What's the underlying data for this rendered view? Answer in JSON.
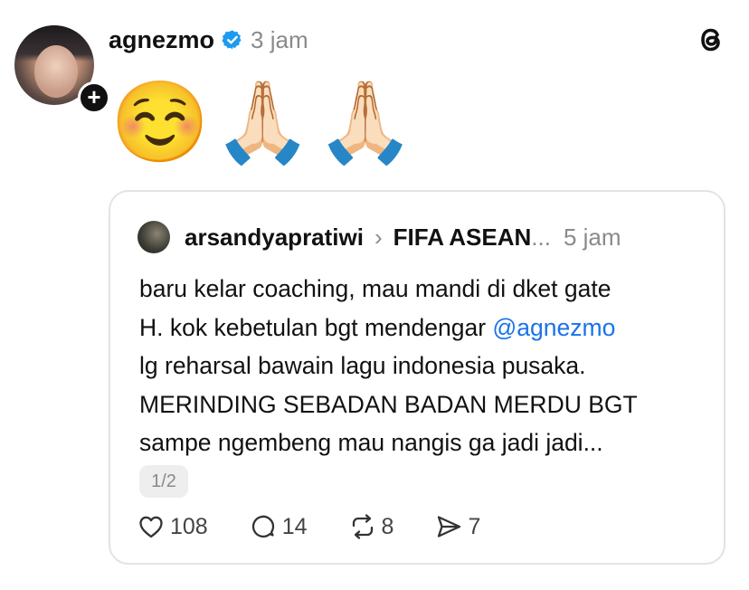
{
  "post": {
    "username": "agnezmo",
    "time": "3 jam",
    "emojis": [
      "☺️",
      "🙏🏻",
      "🙏🏻"
    ],
    "follow_icon": "plus-icon",
    "verified_icon": "verified-badge-icon",
    "brand_icon": "threads-logo-icon"
  },
  "quote": {
    "username": "arsandyapratiwi",
    "group": "FIFA ASEAN",
    "ellipsis": "...",
    "time": "5 jam",
    "lines": [
      "baru kelar coaching, mau mandi di dket gate",
      "H. kok kebetulan bgt mendengar ",
      "lg reharsal bawain lagu indonesia pusaka.",
      "MERINDING SEBADAN BADAN MERDU BGT",
      "sampe ngembeng mau nangis ga jadi jadi..."
    ],
    "mention": "@agnezmo",
    "pager": "1/2",
    "actions": {
      "likes": "108",
      "comments": "14",
      "reposts": "8",
      "shares": "7"
    }
  },
  "colors": {
    "mention": "#1a73e8",
    "verified": "#1d9bf0",
    "muted": "#8a8a8a"
  }
}
